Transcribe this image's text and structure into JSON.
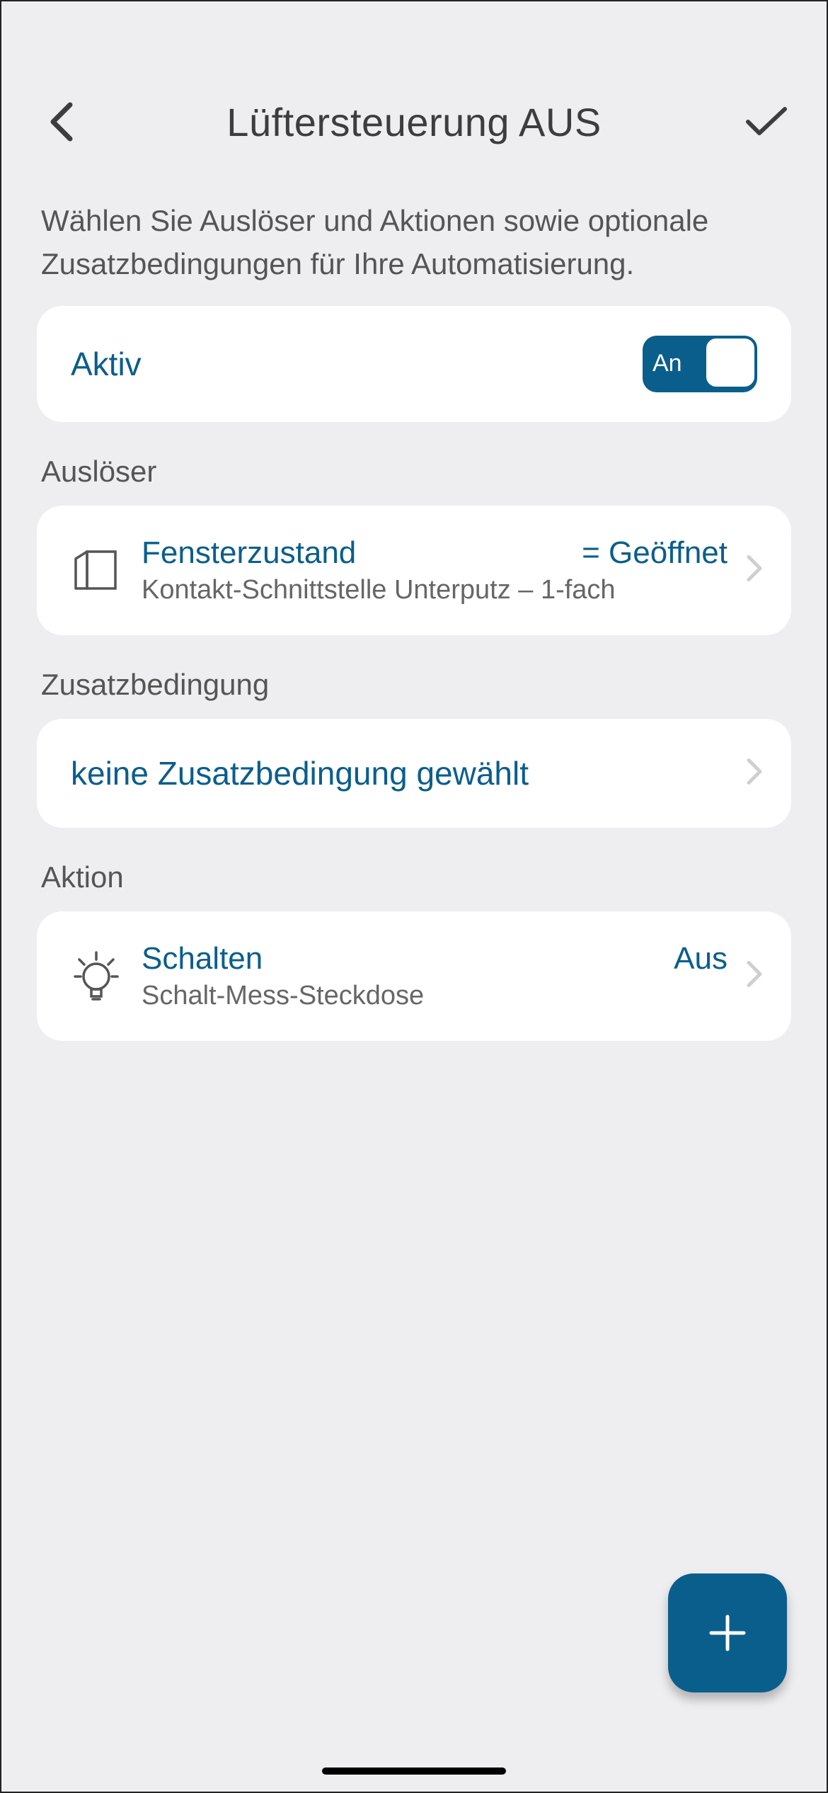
{
  "header": {
    "title": "Lüftersteuerung AUS"
  },
  "description": "Wählen Sie Auslöser und Aktionen sowie optionale Zusatzbedingungen für Ihre Automatisierung.",
  "active": {
    "label": "Aktiv",
    "toggle_state_label": "An",
    "on": true
  },
  "sections": {
    "trigger": {
      "heading": "Auslöser",
      "title": "Fensterzustand",
      "value": "= Geöffnet",
      "subtitle": "Kontakt-Schnittstelle Unterputz – 1-fach"
    },
    "condition": {
      "heading": "Zusatzbedingung",
      "empty_text": "keine Zusatzbedingung gewählt"
    },
    "action": {
      "heading": "Aktion",
      "title": "Schalten",
      "value": "Aus",
      "subtitle": "Schalt-Mess-Steckdose"
    }
  },
  "colors": {
    "accent": "#0a5e8c",
    "bg": "#eeedf0",
    "card": "#ffffff",
    "text": "#4a4a4a"
  },
  "icons": {
    "back": "chevron-left",
    "confirm": "check",
    "trigger": "window-icon",
    "action": "lightbulb-icon",
    "row_chevron": "chevron-right",
    "fab": "plus"
  }
}
